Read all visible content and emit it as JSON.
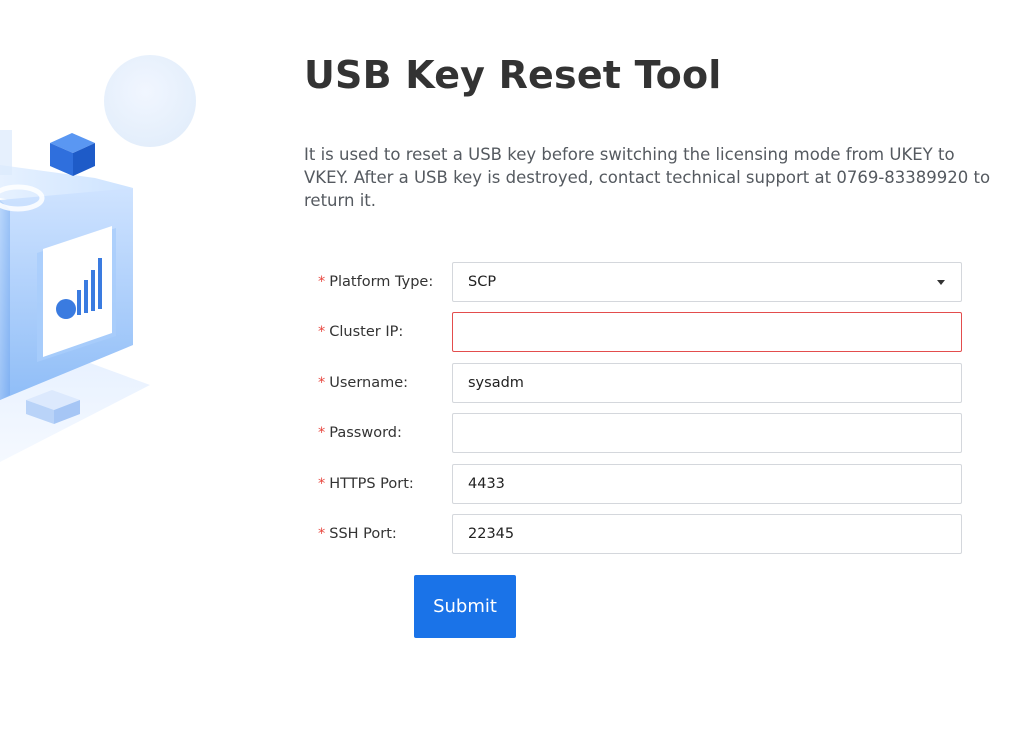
{
  "page": {
    "title": "USB Key Reset Tool",
    "description": "It is used to reset a USB key before switching the licensing mode from UKEY to VKEY. After a USB key is destroyed, contact technical support at 0769-83389920 to return it."
  },
  "form": {
    "required_mark": "*",
    "platform_type": {
      "label": "Platform Type:",
      "value": "SCP"
    },
    "cluster_ip": {
      "label": "Cluster IP:",
      "value": ""
    },
    "username": {
      "label": "Username:",
      "value": "sysadm"
    },
    "password": {
      "label": "Password:",
      "value": ""
    },
    "https_port": {
      "label": "HTTPS Port:",
      "value": "4433"
    },
    "ssh_port": {
      "label": "SSH Port:",
      "value": "22345"
    },
    "submit_label": "Submit"
  },
  "colors": {
    "accent": "#1a73e8",
    "required": "#e8463e",
    "error_border": "#e34d4d"
  },
  "icons": {
    "illustration": "server-cube-chart-illustration",
    "select_caret": "caret-down-icon"
  }
}
